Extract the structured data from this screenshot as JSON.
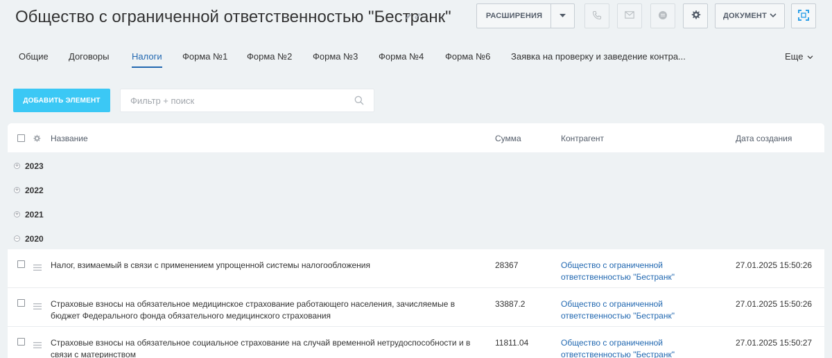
{
  "header": {
    "title": "Общество с ограниченной ответственностью \"Бестранк\"",
    "extensions_label": "РАСШИРЕНИЯ",
    "document_label": "ДОКУМЕНТ"
  },
  "icons": {
    "edit": "pencil-icon",
    "link": "link-icon",
    "phone": "phone-icon",
    "mail": "mail-icon",
    "chat": "chat-icon",
    "settings": "gear-icon",
    "scan": "scan-icon"
  },
  "tabs": [
    {
      "label": "Общие",
      "active": false
    },
    {
      "label": "Договоры",
      "active": false
    },
    {
      "label": "Налоги",
      "active": true
    },
    {
      "label": "Форма №1",
      "active": false
    },
    {
      "label": "Форма №2",
      "active": false
    },
    {
      "label": "Форма №3",
      "active": false
    },
    {
      "label": "Форма №4",
      "active": false
    },
    {
      "label": "Форма №6",
      "active": false
    },
    {
      "label": "Заявка на проверку и заведение контра...",
      "active": false
    }
  ],
  "tabs_more_label": "Еще",
  "actions": {
    "add_label": "ДОБАВИТЬ ЭЛЕМЕНТ",
    "search_placeholder": "Фильтр + поиск",
    "search_value": ""
  },
  "colors": {
    "accent": "#2067b0",
    "add_button": "#3bc8f5",
    "background": "#eef2f4"
  },
  "grid": {
    "columns": {
      "name": "Название",
      "sum": "Сумма",
      "counterparty": "Контрагент",
      "created": "Дата создания"
    },
    "groups": [
      {
        "label": "2023",
        "expanded": false
      },
      {
        "label": "2022",
        "expanded": false
      },
      {
        "label": "2021",
        "expanded": false
      },
      {
        "label": "2020",
        "expanded": true
      }
    ],
    "rows": [
      {
        "name": "Налог, взимаемый в связи с применением упрощенной системы налогообложения",
        "sum": "28367",
        "counterparty": "Общество с ограниченной ответственностью \"Бестранк\"",
        "created": "27.01.2025 15:50:26"
      },
      {
        "name": "Страховые взносы на обязательное медицинское страхование работающего населения, зачисляемые в бюджет Федерального фонда обязательного медицинского страхования",
        "sum": "33887.2",
        "counterparty": "Общество с ограниченной ответственностью \"Бестранк\"",
        "created": "27.01.2025 15:50:26"
      },
      {
        "name": "Страховые взносы на обязательное социальное страхование на случай временной нетрудоспособности и в связи с материнством",
        "sum": "11811.04",
        "counterparty": "Общество с ограниченной ответственностью \"Бестранк\"",
        "created": "27.01.2025 15:50:27"
      }
    ]
  }
}
